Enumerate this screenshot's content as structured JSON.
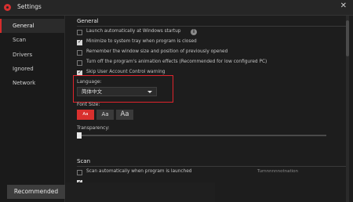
{
  "window": {
    "title": "Settings"
  },
  "sidebar": {
    "items": [
      {
        "label": "General"
      },
      {
        "label": "Scan"
      },
      {
        "label": "Drivers"
      },
      {
        "label": "Ignored"
      },
      {
        "label": "Network"
      }
    ],
    "recommended_label": "Recommended"
  },
  "general": {
    "title": "General",
    "options": [
      {
        "label": "Launch automatically at Windows startup",
        "checked": false
      },
      {
        "label": "Minimize to system tray when program is closed",
        "checked": true
      },
      {
        "label": "Remember the window size and position of previously opened",
        "checked": false
      },
      {
        "label": "Turn off the program's animation effects (Recommended for low configured PC)",
        "checked": false
      },
      {
        "label": "Skip User Account Control warning",
        "checked": true
      }
    ],
    "info_icon_label": "i",
    "language": {
      "label": "Language:",
      "value": "简体中文"
    },
    "font_size": {
      "label": "Font Size:",
      "options": [
        {
          "label": "Aa",
          "selected": true
        },
        {
          "label": "Aa",
          "selected": false
        },
        {
          "label": "Aa",
          "selected": false
        }
      ]
    },
    "transparency": {
      "label": "Transparency:",
      "value_fraction": 0.0
    }
  },
  "scan": {
    "title": "Scan",
    "options": [
      {
        "label": "Scan automatically when program is launched",
        "checked": false
      }
    ],
    "partial_row_text": "Turnnnnnnotnation"
  },
  "colors": {
    "accent": "#d9302e",
    "highlight": "#e0242c",
    "background": "#1d1d1d"
  }
}
